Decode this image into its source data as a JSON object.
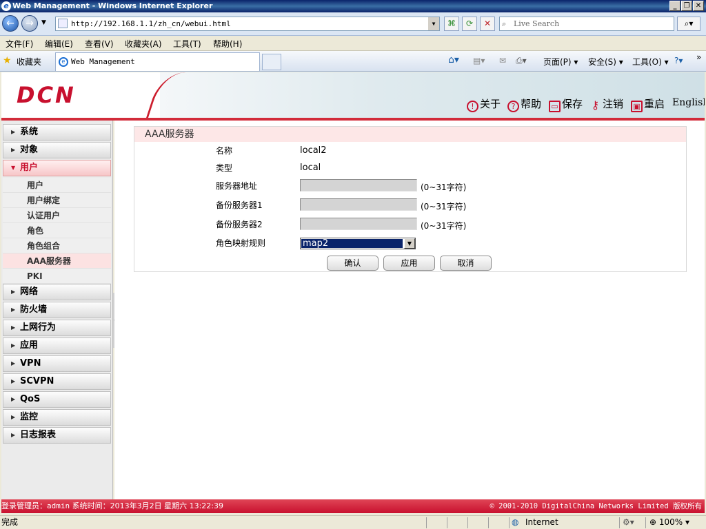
{
  "window": {
    "title": "Web Management - Windows Internet Explorer"
  },
  "address": {
    "url": "http://192.168.1.1/zh_cn/webui.html",
    "search_placeholder": "Live Search"
  },
  "menubar": [
    "文件(F)",
    "编辑(E)",
    "查看(V)",
    "收藏夹(A)",
    "工具(T)",
    "帮助(H)"
  ],
  "favorites": {
    "label": "收藏夹"
  },
  "tab": {
    "title": "Web Management"
  },
  "commandbar": {
    "page": "页面(P)",
    "safety": "安全(S)",
    "tools": "工具(O)"
  },
  "header": {
    "logo": "DCN",
    "links": [
      {
        "icon": "!",
        "label": "关于"
      },
      {
        "icon": "?",
        "label": "帮助"
      },
      {
        "icon": "▭",
        "label": "保存"
      },
      {
        "icon": "⚷",
        "label": "注销"
      },
      {
        "icon": "▣",
        "label": "重启"
      }
    ],
    "english": "English"
  },
  "sidebar": {
    "menus_top": [
      "系统",
      "对象"
    ],
    "active": "用户",
    "subs": [
      "用户",
      "用户绑定",
      "认证用户",
      "角色",
      "角色组合",
      "AAA服务器",
      "PKI"
    ],
    "selected_sub": "AAA服务器",
    "menus_bottom": [
      "网络",
      "防火墙",
      "上网行为",
      "应用",
      "VPN",
      "SCVPN",
      "QoS",
      "监控",
      "日志报表"
    ]
  },
  "form": {
    "title": "AAA服务器",
    "name_label": "名称",
    "name_value": "local2",
    "type_label": "类型",
    "type_value": "local",
    "server_label": "服务器地址",
    "server_value": "",
    "backup1_label": "备份服务器1",
    "backup1_value": "",
    "backup2_label": "备份服务器2",
    "backup2_value": "",
    "hint": "(0~31字符)",
    "rolemap_label": "角色映射规则",
    "rolemap_value": "map2",
    "buttons": {
      "ok": "确认",
      "apply": "应用",
      "cancel": "取消"
    }
  },
  "footer": {
    "login_prefix": "登录管理员：",
    "user": "admin",
    "time_prefix": "系统时间：",
    "time": "2013年3月2日 星期六 13:22:39",
    "copyright": "© 2001-2010 DigitalChina Networks Limited 版权所有"
  },
  "status": {
    "text": "完成",
    "zone": "Internet",
    "zoom": "100%"
  },
  "colors": {
    "brand_red": "#c8102e",
    "panel_head": "#fde7e7"
  }
}
